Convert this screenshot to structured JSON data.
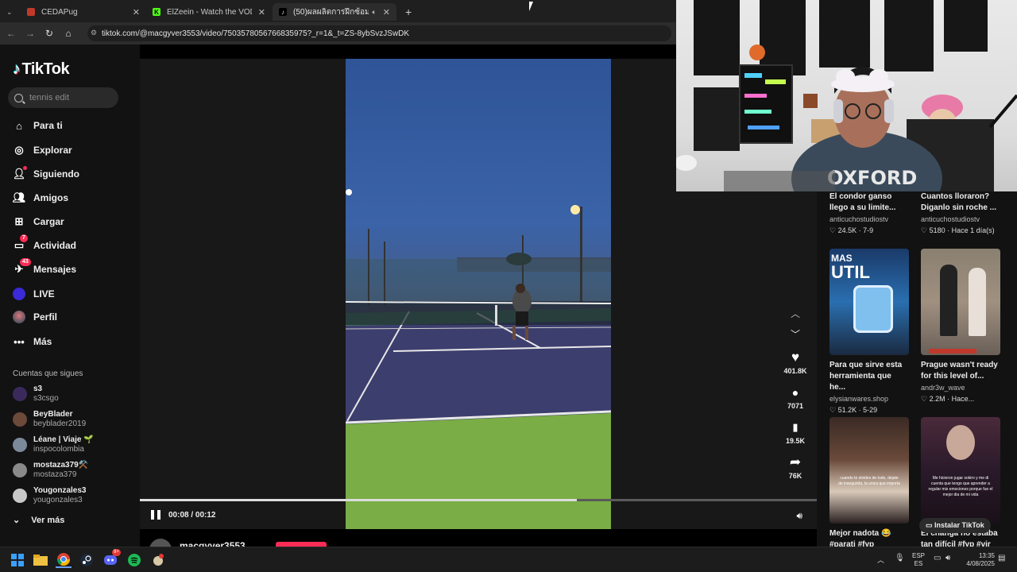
{
  "browser": {
    "tabs": [
      {
        "title": "CEDAPug",
        "icon": "cedapug-icon",
        "active": false
      },
      {
        "title": "ElZeein - Watch the VOD on Kick",
        "icon": "kick-icon",
        "active": false
      },
      {
        "title": "(50)ผลผลิตการฝึกซ้อมเทนนิส...",
        "icon": "tiktok-icon",
        "active": true
      }
    ],
    "new_tab": "+",
    "url": "tiktok.com/@macgyver3553/video/7503578056766835975?_r=1&_t=ZS-8ybSvzJSwDK"
  },
  "sidebar": {
    "logo": "TikTok",
    "search_placeholder": "tennis edit",
    "nav": [
      {
        "label": "Para ti",
        "icon": "home-icon"
      },
      {
        "label": "Explorar",
        "icon": "compass-icon"
      },
      {
        "label": "Siguiendo",
        "icon": "following-icon"
      },
      {
        "label": "Amigos",
        "icon": "friends-icon"
      },
      {
        "label": "Cargar",
        "icon": "upload-icon"
      },
      {
        "label": "Actividad",
        "icon": "activity-icon",
        "badge": "7"
      },
      {
        "label": "Mensajes",
        "icon": "messages-icon",
        "badge": "43"
      },
      {
        "label": "LIVE",
        "icon": "live-icon"
      },
      {
        "label": "Perfil",
        "icon": "profile-icon"
      },
      {
        "label": "Más",
        "icon": "more-icon"
      }
    ],
    "following_title": "Cuentas que sigues",
    "following": [
      {
        "name": "s3",
        "handle": "s3csgo",
        "color": "#3a2a5c"
      },
      {
        "name": "BeyBlader",
        "handle": "beyblader2019",
        "color": "#6b4a3a"
      },
      {
        "name": "Léane | Viaje 🌱",
        "handle": "inspocolombia",
        "color": "#7b8a9a"
      },
      {
        "name": "mostaza379⚒️",
        "handle": "mostaza379",
        "color": "#8a8a8a"
      },
      {
        "name": "Yougonzales3",
        "handle": "yougonzales3",
        "color": "#c8c8c8"
      }
    ],
    "see_more": "Ver más"
  },
  "player": {
    "time": "00:08 / 00:12",
    "progress": 0.645,
    "author": "macgyver3553",
    "actions": [
      {
        "icon": "heart-icon",
        "glyph": "♥",
        "count": "401.8K"
      },
      {
        "icon": "comment-icon",
        "glyph": "●",
        "count": "7071"
      },
      {
        "icon": "bookmark-icon",
        "glyph": "▮",
        "count": "19.5K"
      },
      {
        "icon": "share-icon",
        "glyph": "➦",
        "count": "76K"
      }
    ]
  },
  "feed": {
    "top_cards": [
      {
        "title1": "El condor ganso",
        "title2": "llego a su limite...",
        "author": "anticuchostudiostv",
        "likes": "24.5K",
        "date": "7-9"
      },
      {
        "title1": "Cuantos lloraron?",
        "title2": "Diganlo sin roche ...",
        "author": "anticuchostudiostv",
        "likes": "5180",
        "date": "Hace 1 día(s)"
      }
    ],
    "mid_cards": [
      {
        "thumb_text1": "MAS",
        "thumb_text2": "UTIL",
        "title1": "Para que sirve esta",
        "title2": "herramienta que he...",
        "author": "elysianwares.shop",
        "likes": "51.2K",
        "date": "5-29"
      },
      {
        "title1": "Prague wasn't ready",
        "title2": "for this level of...",
        "author": "andr3w_wave",
        "likes": "2.2M",
        "date": "Hace..."
      }
    ],
    "bottom_cards": [
      {
        "thumb_text": "cuando te olvides de todo, dejate de insegurida, la unica que importa",
        "title1": "Mejor nadota 😂",
        "title2": "#parati #fyp"
      },
      {
        "thumb_text": "Me hicieron jugar sokiro y me di cuenta que tengo que aprender a regular mis emociones porque fue el mejor dia de mi vida",
        "title1": "El changa no estaba",
        "title2": "tan difícil #fyp #vir"
      }
    ],
    "install": "Instalar TikTok"
  },
  "taskbar": {
    "lang1": "ESP",
    "lang2": "ES",
    "time": "13:35",
    "date": "4/08/2025",
    "discord_badge": "9+"
  }
}
